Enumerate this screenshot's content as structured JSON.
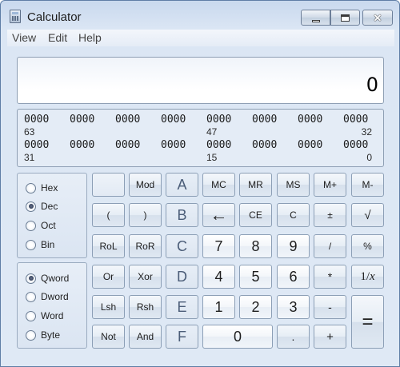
{
  "window": {
    "title": "Calculator",
    "minimize": "–",
    "maximize": "□",
    "close": "✕"
  },
  "menu": [
    "View",
    "Edit",
    "Help"
  ],
  "display": {
    "value": "0"
  },
  "bits": {
    "row1": [
      "0000",
      "0000",
      "0000",
      "0000",
      "0000",
      "0000",
      "0000",
      "0000"
    ],
    "row1_index": [
      "63",
      "47",
      "32"
    ],
    "row2": [
      "0000",
      "0000",
      "0000",
      "0000",
      "0000",
      "0000",
      "0000",
      "0000"
    ],
    "row2_index": [
      "31",
      "15",
      "0"
    ]
  },
  "radix": {
    "options": [
      "Hex",
      "Dec",
      "Oct",
      "Bin"
    ],
    "selected": "Dec"
  },
  "word_size": {
    "options": [
      "Qword",
      "Dword",
      "Word",
      "Byte"
    ],
    "selected": "Qword"
  },
  "keys": {
    "row1": [
      "",
      "Mod",
      "A",
      "MC",
      "MR",
      "MS",
      "M+",
      "M-"
    ],
    "row2": [
      "(",
      ")",
      "B",
      "←",
      "CE",
      "C",
      "±",
      "√"
    ],
    "row3": [
      "RoL",
      "RoR",
      "C",
      "7",
      "8",
      "9",
      "/",
      "%"
    ],
    "row4": [
      "Or",
      "Xor",
      "D",
      "4",
      "5",
      "6",
      "*",
      "1/"
    ],
    "row4_reciprocal_var": "x",
    "row5": [
      "Lsh",
      "Rsh",
      "E",
      "1",
      "2",
      "3",
      "-"
    ],
    "row6": [
      "Not",
      "And",
      "F",
      "0",
      ".",
      "+"
    ],
    "equals": "="
  }
}
